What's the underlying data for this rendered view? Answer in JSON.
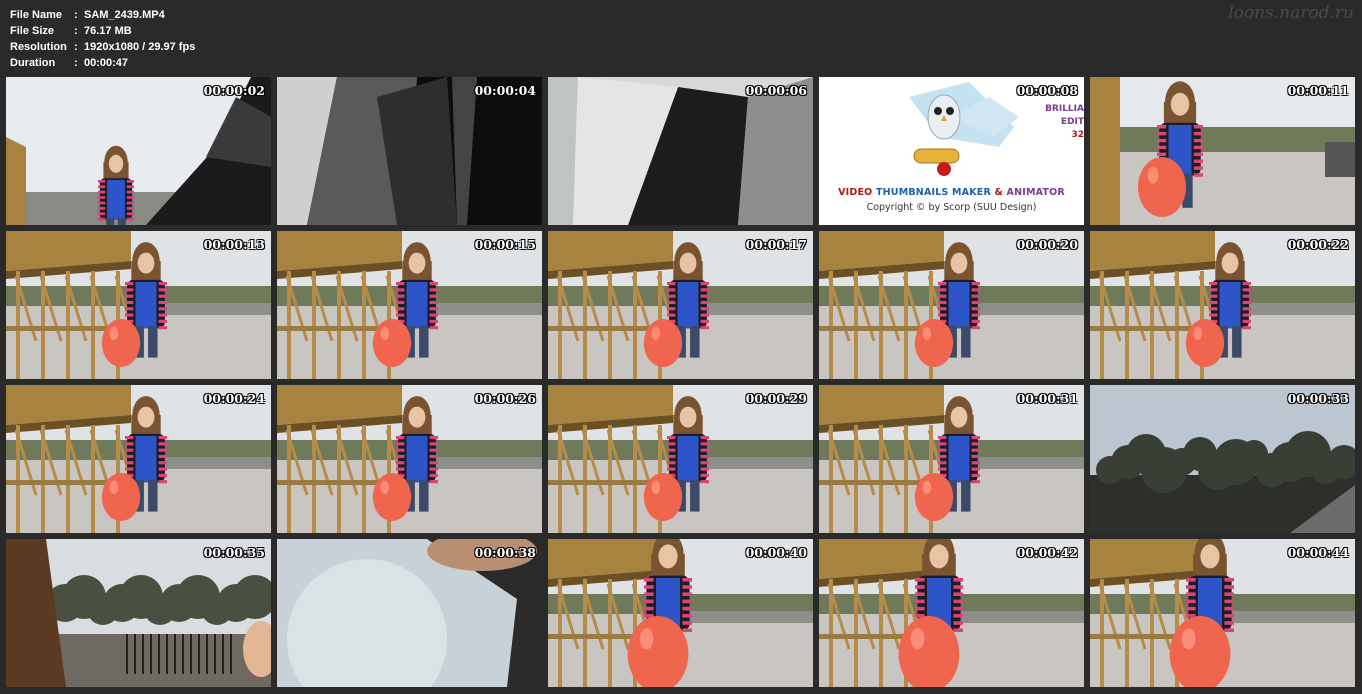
{
  "file_info": {
    "rows": [
      {
        "label": "File Name",
        "value": "SAM_2439.MP4"
      },
      {
        "label": "File Size",
        "value": "76.17 MB"
      },
      {
        "label": "Resolution",
        "value": "1920x1080 / 29.97 fps"
      },
      {
        "label": "Duration",
        "value": "00:00:47"
      }
    ]
  },
  "watermark": "loons.narod.ru",
  "logo": {
    "title_part1": "VIDEO ",
    "title_part2": "THUMBNAILS MAKER",
    "title_part3": " & ",
    "title_part4": "ANIMATOR",
    "copyright": "Copyright © by Scorp (SUU Design)",
    "side_line1": "BRILLIA",
    "side_line2": "EDIT",
    "side_line3": "32",
    "color_red": "#b01818",
    "color_blue": "#1b5fb0",
    "color_purple": "#7a3c8c"
  },
  "thumbnails": [
    {
      "time": "00:00:02",
      "scene": "girl-coat-closeup"
    },
    {
      "time": "00:00:04",
      "scene": "dark-fabric"
    },
    {
      "time": "00:00:06",
      "scene": "argyle-fabric"
    },
    {
      "time": "00:00:08",
      "scene": "logo"
    },
    {
      "time": "00:00:11",
      "scene": "girl-balloon"
    },
    {
      "time": "00:00:13",
      "scene": "girl-balloon-gazebo"
    },
    {
      "time": "00:00:15",
      "scene": "girl-balloon-gazebo"
    },
    {
      "time": "00:00:17",
      "scene": "girl-balloon-gazebo"
    },
    {
      "time": "00:00:20",
      "scene": "girl-balloon-gazebo"
    },
    {
      "time": "00:00:22",
      "scene": "girl-balloon-gazebo"
    },
    {
      "time": "00:00:24",
      "scene": "girl-balloon-gazebo"
    },
    {
      "time": "00:00:26",
      "scene": "girl-balloon-gazebo"
    },
    {
      "time": "00:00:29",
      "scene": "girl-balloon-gazebo"
    },
    {
      "time": "00:00:31",
      "scene": "girl-balloon-gazebo"
    },
    {
      "time": "00:00:33",
      "scene": "trees-sky"
    },
    {
      "time": "00:00:35",
      "scene": "trees-fence"
    },
    {
      "time": "00:00:38",
      "scene": "sky-closeup"
    },
    {
      "time": "00:00:40",
      "scene": "girl-balloon-big"
    },
    {
      "time": "00:00:42",
      "scene": "girl-balloon-big"
    },
    {
      "time": "00:00:44",
      "scene": "girl-balloon-big"
    }
  ]
}
